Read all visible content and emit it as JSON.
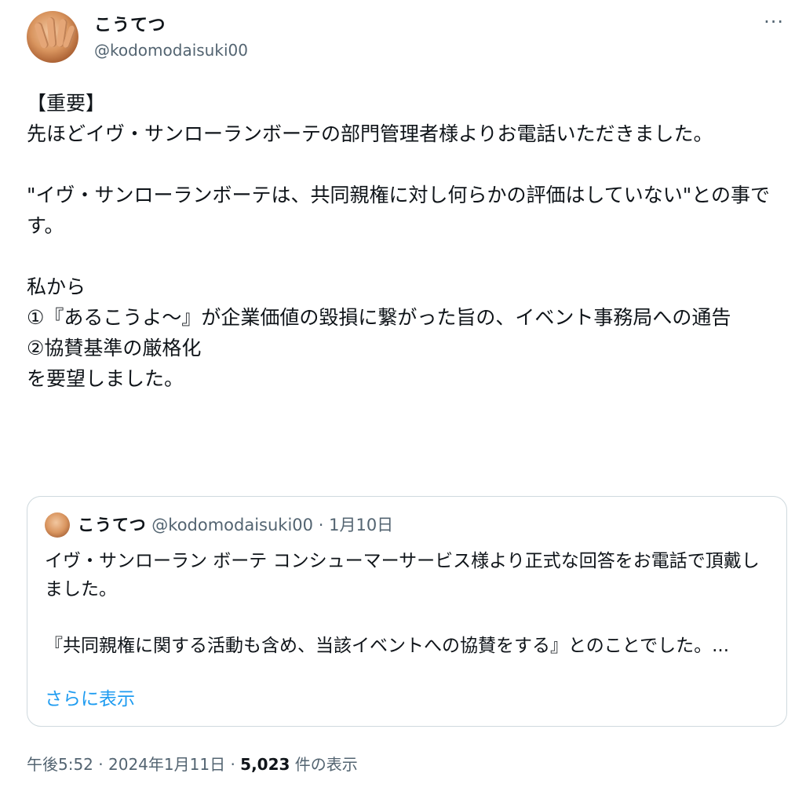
{
  "author": {
    "display_name": "こうてつ",
    "handle": "@kodomodaisuki00"
  },
  "more_icon": "more-horizontal-icon",
  "tweet": {
    "text": "【重要】\n先ほどイヴ・サンローランボーテの部門管理者様よりお電話いただきました。\n\n\"イヴ・サンローランボーテは、共同親権に対し何らかの評価はしていない\"との事です。\n\n私から\n①『あるこうよ～』が企業価値の毀損に繋がった旨の、イベント事務局への通告\n②協賛基準の厳格化\nを要望しました。"
  },
  "quoted_tweet": {
    "display_name": "こうてつ",
    "handle": "@kodomodaisuki00",
    "separator": "·",
    "date": "1月10日",
    "text": "イヴ・サンローラン ボーテ コンシューマーサービス様より正式な回答をお電話で頂戴しました。\n\n『共同親権に関する活動も含め、当該イベントへの協賛をする』とのことでした。...",
    "show_more": "さらに表示"
  },
  "footer": {
    "time": "午後5:52",
    "sep1": "·",
    "date": "2024年1月11日",
    "sep2": "·",
    "views_count": "5,023",
    "views_label": "件の表示"
  },
  "colors": {
    "text": "#0f1419",
    "secondary": "#536471",
    "link": "#1d9bf0",
    "border": "#cfd9de"
  }
}
